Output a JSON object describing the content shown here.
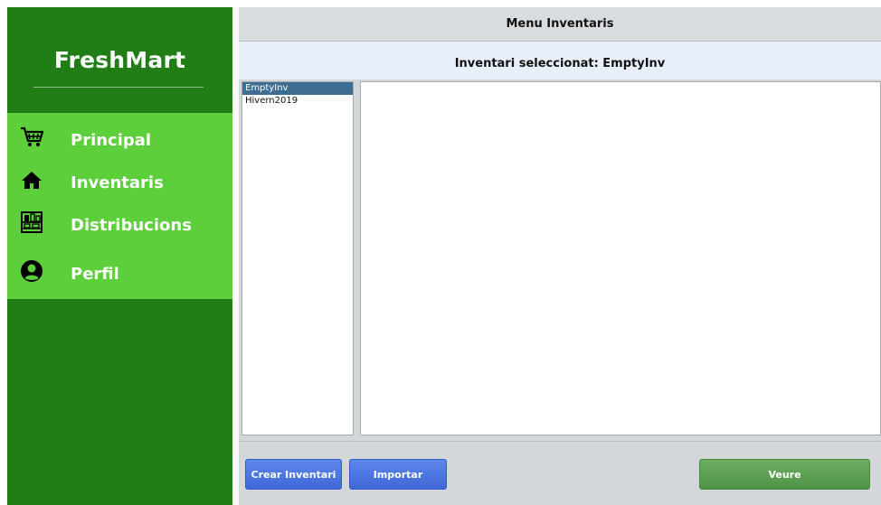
{
  "brand": "FreshMart",
  "sidebar": {
    "items": [
      {
        "label": "Principal",
        "icon": "shopping-cart-icon"
      },
      {
        "label": "Inventaris",
        "icon": "home-icon"
      },
      {
        "label": "Distribucions",
        "icon": "shelves-icon"
      },
      {
        "label": "Perfil",
        "icon": "user-circle-icon"
      }
    ]
  },
  "main": {
    "title": "Menu Inventaris",
    "selected_text": "Inventari seleccionat: EmptyInv",
    "inventories": [
      "EmptyInv",
      "Hivern2019"
    ],
    "selected_inventory": "EmptyInv"
  },
  "buttons": {
    "create": "Crear Inventari",
    "import": "Importar",
    "view": "Veure"
  },
  "colors": {
    "sidebar_dark": "#217e17",
    "sidebar_menu": "#5ccf3a",
    "button_blue": "#4a74df",
    "button_green": "#5aa150",
    "selection": "#3e6d94"
  }
}
